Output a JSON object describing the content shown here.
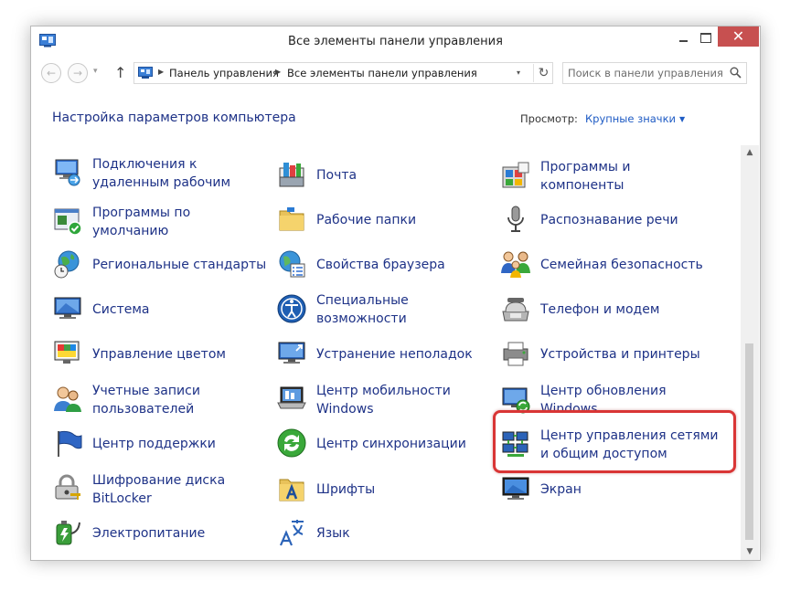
{
  "window": {
    "title": "Все элементы панели управления",
    "close_glyph": "✕"
  },
  "nav": {
    "back_glyph": "←",
    "forward_glyph": "→",
    "recent_glyph": "▾",
    "up_glyph": "↑",
    "breadcrumbs": [
      "Панель управления",
      "Все элементы панели управления"
    ],
    "refresh_glyph": "↻",
    "dropdown_glyph": "▾",
    "search_placeholder": "Поиск в панели управления"
  },
  "header": {
    "title": "Настройка параметров компьютера",
    "view_label": "Просмотр:",
    "view_value": "Крупные значки",
    "view_caret": "▼"
  },
  "scrollbar": {
    "up_glyph": "▲",
    "down_glyph": "▼"
  },
  "items": {
    "col1": [
      {
        "lines": [
          "Подключения к",
          "удаленным рабочим"
        ],
        "icon": "remote-desktop-icon"
      },
      {
        "lines": [
          "Программы по",
          "умолчанию"
        ],
        "icon": "default-programs-icon"
      },
      {
        "lines": [
          "Региональные стандарты"
        ],
        "icon": "region-icon"
      },
      {
        "lines": [
          "Система"
        ],
        "icon": "system-icon"
      },
      {
        "lines": [
          "Управление цветом"
        ],
        "icon": "color-management-icon"
      },
      {
        "lines": [
          "Учетные записи",
          "пользователей"
        ],
        "icon": "user-accounts-icon"
      },
      {
        "lines": [
          "Центр поддержки"
        ],
        "icon": "action-center-icon"
      },
      {
        "lines": [
          "Шифрование диска",
          "BitLocker"
        ],
        "icon": "bitlocker-icon"
      },
      {
        "lines": [
          "Электропитание"
        ],
        "icon": "power-options-icon"
      }
    ],
    "col2": [
      {
        "lines": [
          "Почта"
        ],
        "icon": "mail-icon"
      },
      {
        "lines": [
          "Рабочие папки"
        ],
        "icon": "work-folders-icon"
      },
      {
        "lines": [
          "Свойства браузера"
        ],
        "icon": "internet-options-icon"
      },
      {
        "lines": [
          "Специальные",
          "возможности"
        ],
        "icon": "ease-of-access-icon"
      },
      {
        "lines": [
          "Устранение неполадок"
        ],
        "icon": "troubleshooting-icon"
      },
      {
        "lines": [
          "Центр мобильности",
          "Windows"
        ],
        "icon": "mobility-center-icon"
      },
      {
        "lines": [
          "Центр синхронизации"
        ],
        "icon": "sync-center-icon"
      },
      {
        "lines": [
          "Шрифты"
        ],
        "icon": "fonts-icon"
      },
      {
        "lines": [
          "Язык"
        ],
        "icon": "language-icon"
      }
    ],
    "col3": [
      {
        "lines": [
          "Программы и",
          "компоненты"
        ],
        "icon": "programs-features-icon"
      },
      {
        "lines": [
          "Распознавание речи"
        ],
        "icon": "speech-recognition-icon"
      },
      {
        "lines": [
          "Семейная безопасность"
        ],
        "icon": "family-safety-icon"
      },
      {
        "lines": [
          "Телефон и модем"
        ],
        "icon": "phone-modem-icon"
      },
      {
        "lines": [
          "Устройства и принтеры"
        ],
        "icon": "devices-printers-icon"
      },
      {
        "lines": [
          "Центр обновления",
          "Windows"
        ],
        "icon": "windows-update-icon"
      },
      {
        "lines": [
          "Центр управления сетями",
          "и общим доступом"
        ],
        "icon": "network-sharing-icon"
      },
      {
        "lines": [
          "Экран"
        ],
        "icon": "display-icon"
      }
    ]
  },
  "colors": {
    "link": "#1e3287",
    "highlight": "#d93535",
    "close": "#c75050"
  }
}
